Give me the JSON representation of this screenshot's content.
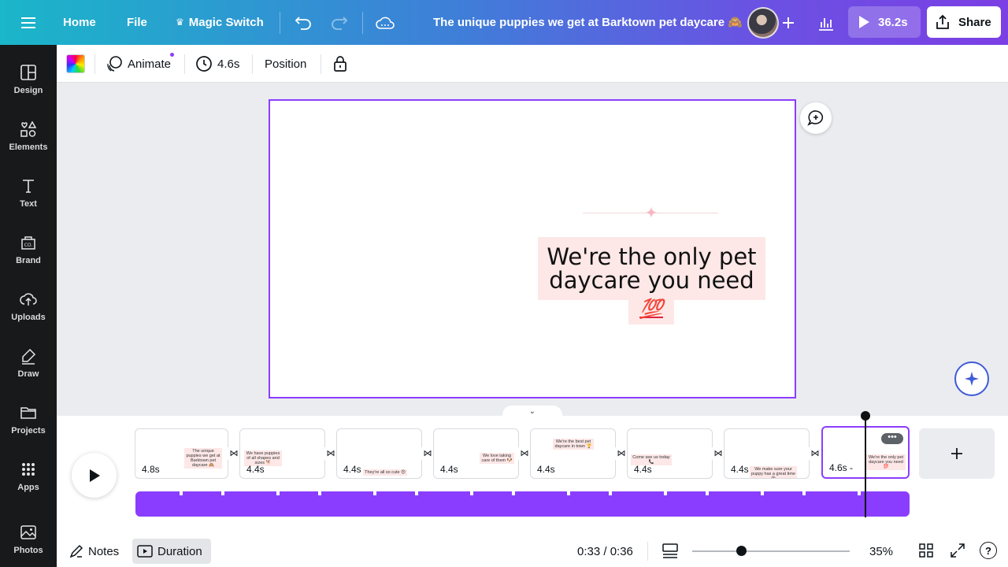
{
  "topbar": {
    "menu_icon": "hamburger-icon",
    "home": "Home",
    "file": "File",
    "magic_switch": "Magic Switch",
    "title": "The unique puppies we get at Barktown pet daycare 🙈",
    "present_duration": "36.2s",
    "share": "Share"
  },
  "sidebar": {
    "items": [
      {
        "label": "Design",
        "icon": "design-icon"
      },
      {
        "label": "Elements",
        "icon": "elements-icon"
      },
      {
        "label": "Text",
        "icon": "text-icon"
      },
      {
        "label": "Brand",
        "icon": "brand-icon"
      },
      {
        "label": "Uploads",
        "icon": "upload-icon"
      },
      {
        "label": "Draw",
        "icon": "draw-icon"
      },
      {
        "label": "Projects",
        "icon": "folder-icon"
      },
      {
        "label": "Apps",
        "icon": "apps-icon"
      },
      {
        "label": "Photos",
        "icon": "photos-icon"
      }
    ]
  },
  "toolbar": {
    "animate": "Animate",
    "duration": "4.6s",
    "position": "Position"
  },
  "canvas": {
    "headline": "We're the only pet daycare you need",
    "emoji": "💯"
  },
  "timeline": {
    "pages": [
      {
        "duration": "4.8s",
        "thumb_text": "The unique puppies we get at Barktown pet daycare 🙈"
      },
      {
        "duration": "4.4s",
        "thumb_text": "We have puppies of all shapes and sizes 🐕"
      },
      {
        "duration": "4.4s",
        "thumb_text": "They're all so cute 😍"
      },
      {
        "duration": "4.4s",
        "thumb_text": "We love taking care of them 🐶"
      },
      {
        "duration": "4.4s",
        "thumb_text": "We're the best pet daycare in town 🏆"
      },
      {
        "duration": "4.4s",
        "thumb_text": "Come see us today 📞"
      },
      {
        "duration": "4.4s",
        "thumb_text": "We make sure your puppy has a great time 😍"
      },
      {
        "duration": "4.6s -",
        "thumb_text": "We're the only pet daycare you need 💯"
      }
    ],
    "more_menu": "•••"
  },
  "footer": {
    "notes": "Notes",
    "duration": "Duration",
    "time": "0:33 / 0:36",
    "zoom": "35%",
    "help": "?"
  }
}
